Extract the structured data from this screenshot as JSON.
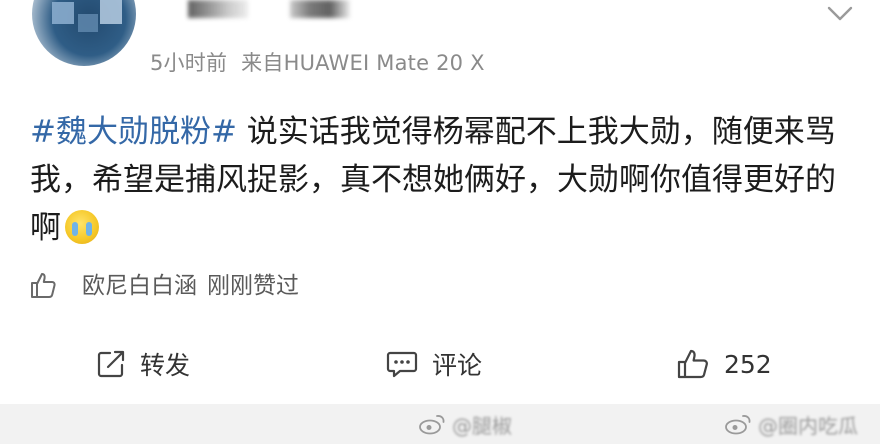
{
  "post": {
    "time": "5小时前",
    "source": "来自HUAWEI Mate 20 X",
    "hashtag": "#魏大勋脱粉#",
    "text": " 说实话我觉得杨幂配不上我大勋，随便来骂我，希望是捕风捉影，真不想她俩好，大勋啊你值得更好的啊"
  },
  "likes_line": {
    "names": "欧尼白白涵",
    "suffix": "刚刚赞过"
  },
  "actions": {
    "repost_label": "转发",
    "comment_label": "评论",
    "like_count": "252"
  },
  "colors": {
    "hashtag": "#3468a7",
    "meta_text": "#8a8a8a",
    "footer": "#f2f2f2"
  }
}
